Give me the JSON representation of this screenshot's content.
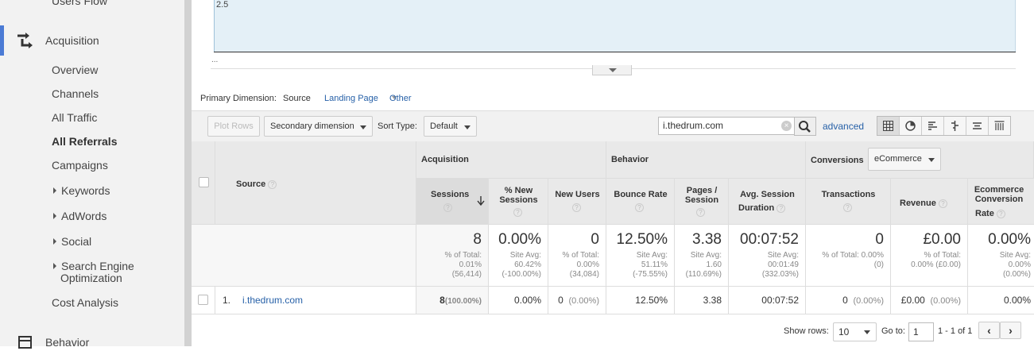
{
  "sidebar": {
    "users_flow": "Users Flow",
    "acquisition": "Acquisition",
    "items": [
      "Overview",
      "Channels",
      "All Traffic",
      "All Referrals",
      "Campaigns"
    ],
    "expandable": [
      "Keywords",
      "AdWords",
      "Social"
    ],
    "seo_line1": "Search Engine",
    "seo_line2": "Optimization",
    "cost": "Cost Analysis",
    "behavior": "Behavior",
    "active_item": "All Referrals"
  },
  "chart": {
    "y_tick": "2.5",
    "ellipsis": "..."
  },
  "primary_dimension": {
    "label": "Primary Dimension:",
    "active": "Source",
    "landing": "Landing Page",
    "other": "Other"
  },
  "toolbar": {
    "plot_rows": "Plot Rows",
    "secondary_dimension": "Secondary dimension",
    "sort_type_label": "Sort Type:",
    "sort_type": "Default",
    "search_value": "i.thedrum.com",
    "advanced": "advanced"
  },
  "table": {
    "source_header": "Source",
    "group_acquisition": "Acquisition",
    "group_behavior": "Behavior",
    "group_conversions": "Conversions",
    "conversions_select": "eCommerce",
    "cols": {
      "sessions": "Sessions",
      "new_sessions_1": "% New",
      "new_sessions_2": "Sessions",
      "new_users": "New Users",
      "bounce": "Bounce Rate",
      "pages_1": "Pages /",
      "pages_2": "Session",
      "avg_1": "Avg. Session",
      "avg_2": "Duration",
      "transactions": "Transactions",
      "revenue": "Revenue",
      "ecr_1": "Ecommerce",
      "ecr_2": "Conversion",
      "ecr_3": "Rate"
    },
    "totals": {
      "sessions": "8",
      "sessions_s1": "% of Total:",
      "sessions_s2": "0.01%",
      "sessions_s3": "(56,414)",
      "new_sessions": "0.00%",
      "new_sessions_s1": "Site Avg:",
      "new_sessions_s2": "60.42%",
      "new_sessions_s3": "(-100.00%)",
      "new_users": "0",
      "new_users_s1": "% of Total:",
      "new_users_s2": "0.00%",
      "new_users_s3": "(34,084)",
      "bounce": "12.50%",
      "bounce_s1": "Site Avg:",
      "bounce_s2": "51.11%",
      "bounce_s3": "(-75.55%)",
      "pages": "3.38",
      "pages_s1": "Site Avg:",
      "pages_s2": "1.60",
      "pages_s3": "(110.69%)",
      "avg": "00:07:52",
      "avg_s1": "Site Avg:",
      "avg_s2": "00:01:49",
      "avg_s3": "(332.03%)",
      "transactions": "0",
      "transactions_s1": "% of Total: 0.00%",
      "transactions_s2": "(0)",
      "revenue": "£0.00",
      "revenue_s1": "% of Total:",
      "revenue_s2": "0.00% (£0.00)",
      "ecr": "0.00%",
      "ecr_s1": "Site Avg:",
      "ecr_s2": "0.00%",
      "ecr_s3": "(0.00%)"
    },
    "row": {
      "index": "1.",
      "source": "i.thedrum.com",
      "sessions": "8",
      "sessions_pct": "(100.00%)",
      "new_sessions": "0.00%",
      "new_users": "0",
      "new_users_pct": "(0.00%)",
      "bounce": "12.50%",
      "pages": "3.38",
      "avg": "00:07:52",
      "transactions": "0",
      "transactions_pct": "(0.00%)",
      "revenue": "£0.00",
      "revenue_pct": "(0.00%)",
      "ecr": "0.00%"
    }
  },
  "pager": {
    "show_rows_label": "Show rows:",
    "show_rows": "10",
    "goto_label": "Go to:",
    "goto_value": "1",
    "range": "1 - 1 of 1"
  }
}
